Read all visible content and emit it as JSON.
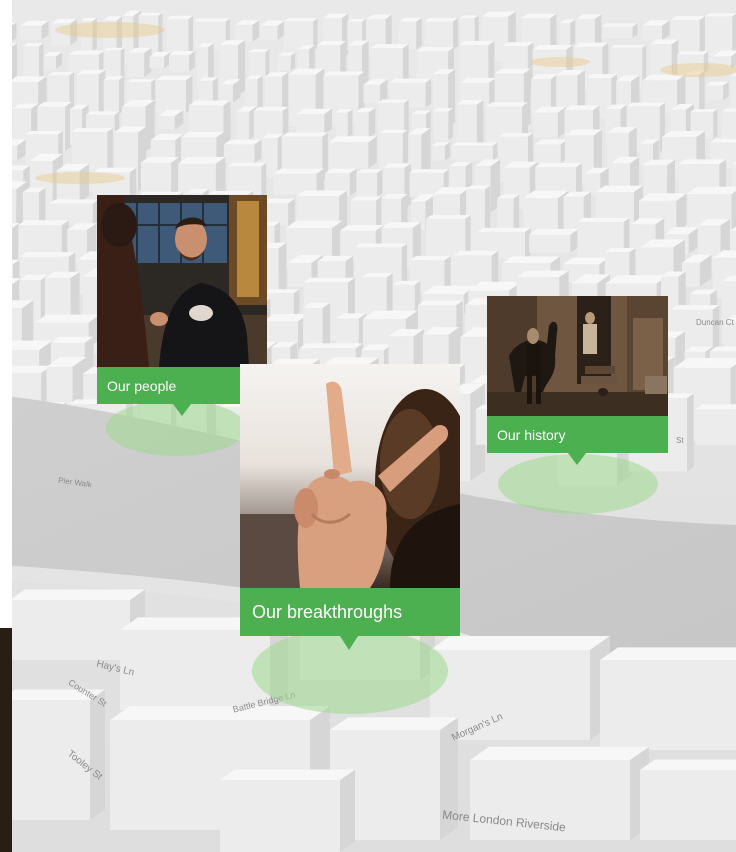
{
  "colors": {
    "accent_green": "#4caf50",
    "halo_green": "#9ed98f",
    "banner_text": "#ffffff"
  },
  "map": {
    "style": "3d-buildings-light",
    "street_labels": [
      "Hay's Ln",
      "Battle Bridge Ln",
      "Tooley St",
      "Morgan's Ln",
      "More London Riverside",
      "Counter St",
      "Duncan Ct",
      "Pier Walk",
      "St"
    ]
  },
  "markers": [
    {
      "label": "Our people",
      "photo_icon": "people-photo-icon"
    },
    {
      "label": "Our breakthroughs",
      "photo_icon": "breakthroughs-photo-icon"
    },
    {
      "label": "Our history",
      "photo_icon": "history-photo-icon"
    }
  ]
}
